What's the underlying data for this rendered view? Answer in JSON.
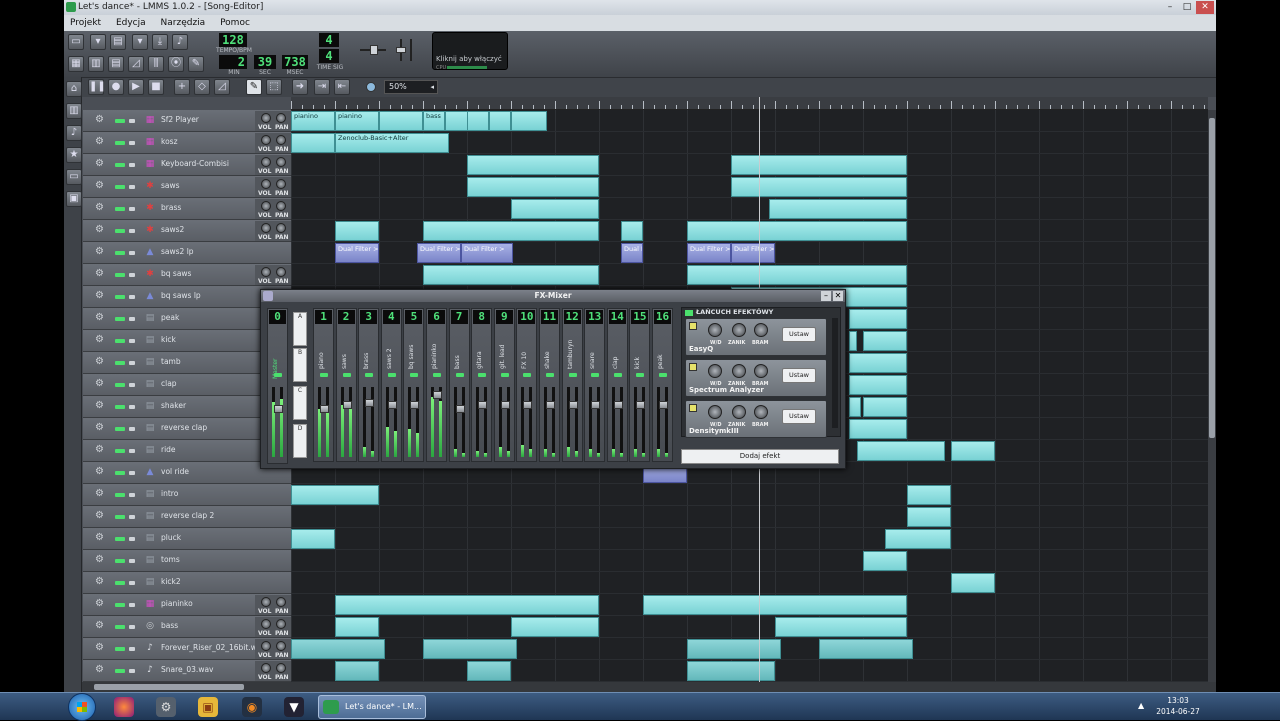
{
  "window": {
    "title": "Let's dance* - LMMS 1.0.2 - [Song-Editor]",
    "minimize": "–",
    "maximize": "□",
    "close": "✕"
  },
  "menu": [
    "Projekt",
    "Edycja",
    "Narzędzia",
    "Pomoc"
  ],
  "toolbar": {
    "tempo_value": "128",
    "tempo_label": "TEMPO/BPM",
    "time_min": "2",
    "time_sec": "39",
    "time_msec": "738",
    "label_min": "MIN",
    "label_sec": "SEC",
    "label_msec": "MSEC",
    "timesig_num": "4",
    "timesig_den": "4",
    "timesig_label": "TIME SIG",
    "cpu_text": "Kliknij aby włączyć",
    "cpu_label": "CPU",
    "zoom": "50%"
  },
  "tracks": [
    {
      "name": "Sf2 Player",
      "icon": "sf2-icon",
      "color": "#d64ec9",
      "vp": true
    },
    {
      "name": "kosz",
      "icon": "sf2-icon",
      "color": "#d64ec9",
      "vp": true
    },
    {
      "name": "Keyboard-Combisi",
      "icon": "sf2-icon",
      "color": "#d64ec9",
      "vp": true
    },
    {
      "name": "saws",
      "icon": "triple-osc-icon",
      "color": "#e04040",
      "vp": true
    },
    {
      "name": "brass",
      "icon": "triple-osc-icon",
      "color": "#e04040",
      "vp": true
    },
    {
      "name": "saws2",
      "icon": "triple-osc-icon",
      "color": "#e04040",
      "vp": true
    },
    {
      "name": "saws2 lp",
      "icon": "automation-icon",
      "color": "#7a8ad8",
      "vp": false
    },
    {
      "name": "bq saws",
      "icon": "triple-osc-icon",
      "color": "#e04040",
      "vp": true
    },
    {
      "name": "bq saws lp",
      "icon": "automation-icon",
      "color": "#7a8ad8",
      "vp": false
    },
    {
      "name": "peak",
      "icon": "beat-icon",
      "color": "#9aa2ab",
      "vp": false
    },
    {
      "name": "kick",
      "icon": "beat-icon",
      "color": "#9aa2ab",
      "vp": false
    },
    {
      "name": "tamb",
      "icon": "beat-icon",
      "color": "#9aa2ab",
      "vp": false
    },
    {
      "name": "clap",
      "icon": "beat-icon",
      "color": "#9aa2ab",
      "vp": false
    },
    {
      "name": "shaker",
      "icon": "beat-icon",
      "color": "#9aa2ab",
      "vp": false
    },
    {
      "name": "reverse clap",
      "icon": "beat-icon",
      "color": "#9aa2ab",
      "vp": false
    },
    {
      "name": "ride",
      "icon": "beat-icon",
      "color": "#9aa2ab",
      "vp": false
    },
    {
      "name": "vol ride",
      "icon": "automation-icon",
      "color": "#7a8ad8",
      "vp": false
    },
    {
      "name": "intro",
      "icon": "beat-icon",
      "color": "#9aa2ab",
      "vp": false
    },
    {
      "name": "reverse clap 2",
      "icon": "beat-icon",
      "color": "#9aa2ab",
      "vp": false
    },
    {
      "name": "pluck",
      "icon": "beat-icon",
      "color": "#9aa2ab",
      "vp": false
    },
    {
      "name": "toms",
      "icon": "beat-icon",
      "color": "#9aa2ab",
      "vp": false
    },
    {
      "name": "kick2",
      "icon": "beat-icon",
      "color": "#9aa2ab",
      "vp": false
    },
    {
      "name": "pianinko",
      "icon": "sf2-icon",
      "color": "#d64ec9",
      "vp": true
    },
    {
      "name": "bass",
      "icon": "organic-icon",
      "color": "#c8ccd0",
      "vp": true
    },
    {
      "name": "Forever_Riser_02_16bit.w",
      "icon": "audio-file-icon",
      "color": "#dfe3e8",
      "vp": true
    },
    {
      "name": "Snare_03.wav",
      "icon": "audio-file-icon",
      "color": "#dfe3e8",
      "vp": true
    }
  ],
  "vp_labels": {
    "vol": "VOL",
    "pan": "PAN"
  },
  "clip_labels": {
    "piano1": "pianino",
    "piano2": "pianino",
    "bass": "bass",
    "kosz1": "Zenoclub-Basic+Alter"
  },
  "automation_label": "Dual Filter >",
  "fx_mixer": {
    "title": "FX-Mixer",
    "master_num": "0",
    "master_name": "Master",
    "sends": [
      "A",
      "B",
      "C",
      "D"
    ],
    "channels": [
      {
        "num": "1",
        "name": "piano"
      },
      {
        "num": "2",
        "name": "saws"
      },
      {
        "num": "3",
        "name": "brass"
      },
      {
        "num": "4",
        "name": "saws 2"
      },
      {
        "num": "5",
        "name": "bq saws"
      },
      {
        "num": "6",
        "name": "pianinko"
      },
      {
        "num": "7",
        "name": "bass"
      },
      {
        "num": "8",
        "name": "gitara"
      },
      {
        "num": "9",
        "name": "git. lead"
      },
      {
        "num": "10",
        "name": "FX 10"
      },
      {
        "num": "11",
        "name": "shake"
      },
      {
        "num": "12",
        "name": "tamburyn"
      },
      {
        "num": "13",
        "name": "snare"
      },
      {
        "num": "14",
        "name": "clap"
      },
      {
        "num": "15",
        "name": "kick"
      },
      {
        "num": "16",
        "name": "peak"
      }
    ],
    "chain_title": "ŁAŃCUCH EFEKTÓWY",
    "effects": [
      {
        "name": "EasyQ",
        "button": "Ustaw"
      },
      {
        "name": "Spectrum Analyzer",
        "button": "Ustaw"
      },
      {
        "name": "DensitymkIII",
        "button": "Ustaw"
      }
    ],
    "knob_labels": [
      "W/D",
      "ZANIK",
      "BRAM"
    ],
    "add_effect": "Dodaj efekt"
  },
  "taskbar": {
    "active_task": "Let's dance* - LM...",
    "time": "13:03",
    "date": "2014-06-27"
  },
  "colors": {
    "clip": "#8fdfe0",
    "automation_clip": "#8f98d8",
    "lcd_text": "#4fe07a",
    "playhead": "#c9ccd0"
  }
}
